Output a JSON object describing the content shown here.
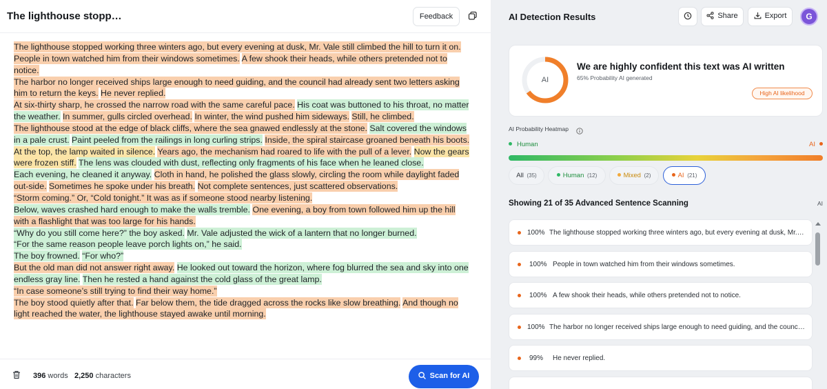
{
  "left": {
    "doc_title": "The lighthouse stopp…",
    "feedback_label": "Feedback",
    "sentences": [
      {
        "t": "The lighthouse stopped working three winters ago, but every evening at dusk, Mr. Vale still climbed the hill to turn it on.",
        "c": "ai",
        "br": true
      },
      {
        "t": "People in town watched him from their windows sometimes.",
        "c": "ai"
      },
      {
        "t": "A few shook their heads, while others pretended not to notice.",
        "c": "ai",
        "br": true
      },
      {
        "t": "The harbor no longer received ships large enough to need guiding, and the council had already sent two letters asking him to return the keys.",
        "c": "ai"
      },
      {
        "t": "He never replied.",
        "c": "ai",
        "br": true
      },
      {
        "t": "At six-thirty sharp, he crossed the narrow road with the same careful pace.",
        "c": "ai"
      },
      {
        "t": "His coat was buttoned to his throat, no matter the weather.",
        "c": "human"
      },
      {
        "t": "In summer, gulls circled overhead.",
        "c": "ai"
      },
      {
        "t": "In winter, the wind pushed him sideways.",
        "c": "ai"
      },
      {
        "t": "Still, he climbed.",
        "c": "ai",
        "br": true
      },
      {
        "t": "The lighthouse stood at the edge of black cliffs, where the sea gnawed endlessly at the stone.",
        "c": "ai"
      },
      {
        "t": "Salt covered the windows in a pale crust.",
        "c": "human"
      },
      {
        "t": "Paint peeled from the railings in long curling strips.",
        "c": "human"
      },
      {
        "t": "Inside, the spiral staircase groaned beneath his boots.",
        "c": "ai",
        "br": true
      },
      {
        "t": "At the top, the lamp waited in silence.",
        "c": "mixed"
      },
      {
        "t": "Years ago, the mechanism had roared to life with the pull of a lever.",
        "c": "ai"
      },
      {
        "t": "Now the gears were frozen stiff.",
        "c": "mixed"
      },
      {
        "t": "The lens was clouded with dust, reflecting only fragments of his face when he leaned close.",
        "c": "human",
        "br": true
      },
      {
        "t": "Each evening, he cleaned it anyway.",
        "c": "human"
      },
      {
        "t": "Cloth in hand, he polished the glass slowly, circling the room while daylight faded out-side.",
        "c": "ai"
      },
      {
        "t": "Sometimes he spoke under his breath.",
        "c": "ai"
      },
      {
        "t": "Not complete sentences, just scattered observations.",
        "c": "ai",
        "br": true
      },
      {
        "t": "“Storm coming.” Or, “Cold tonight.” It was as if someone stood nearby listening.",
        "c": "ai",
        "br": true
      },
      {
        "t": "Below, waves crashed hard enough to make the walls tremble.",
        "c": "human"
      },
      {
        "t": "One evening, a boy from town followed him up the hill with a flashlight that was too large for his hands.",
        "c": "ai",
        "br": true
      },
      {
        "t": "“Why do you still come here?” the boy asked.",
        "c": "human"
      },
      {
        "t": "Mr. Vale adjusted the wick of a lantern that no longer burned.",
        "c": "human",
        "br": true
      },
      {
        "t": "“For the same reason people leave porch lights on,” he said.",
        "c": "human",
        "br": true
      },
      {
        "t": "The boy frowned.",
        "c": "human"
      },
      {
        "t": "“For who?”",
        "c": "human",
        "br": true
      },
      {
        "t": "But the old man did not answer right away.",
        "c": "ai"
      },
      {
        "t": "He looked out toward the horizon, where fog blurred the sea and sky into one endless gray line.",
        "c": "human"
      },
      {
        "t": "Then he rested a hand against the cold glass of the great lamp.",
        "c": "human",
        "br": true
      },
      {
        "t": "“In case someone’s still trying to find their way home.”",
        "c": "ai",
        "br": true
      },
      {
        "t": "The boy stood quietly after that.",
        "c": "ai"
      },
      {
        "t": "Far below them, the tide dragged across the rocks like slow breathing.",
        "c": "ai"
      },
      {
        "t": "And though no light reached the water, the lighthouse stayed awake until morning.",
        "c": "ai"
      }
    ],
    "footer": {
      "words": "396",
      "words_label": "words",
      "chars": "2,250",
      "chars_label": "characters",
      "scan_label": "Scan for AI"
    }
  },
  "right": {
    "title": "AI Detection Results",
    "share_label": "Share",
    "export_label": "Export",
    "avatar_initial": "G",
    "summary": {
      "gauge_label": "AI",
      "gauge_value": 0.65,
      "verdict": "We are highly confident this text was AI written",
      "probability": "65% Probability AI generated",
      "badge": "High AI likelihood"
    },
    "heatmap": {
      "label": "AI Probability Heatmap",
      "left_label": "Human",
      "right_label": "AI"
    },
    "filters": {
      "all": {
        "label": "All",
        "count": "(35)"
      },
      "human": {
        "label": "Human",
        "count": "(12)"
      },
      "mixed": {
        "label": "Mixed",
        "count": "(2)"
      },
      "ai": {
        "label": "AI",
        "count": "(21)"
      }
    },
    "showing": "Showing 21 of 35 Advanced Sentence Scanning",
    "showing_tag": "AI",
    "sentences": [
      {
        "pct": "100%",
        "text": "The lighthouse stopped working three winters ago, but every evening at dusk, Mr. Vale still climbed the hill to turn it on."
      },
      {
        "pct": "100%",
        "text": "People in town watched him from their windows sometimes."
      },
      {
        "pct": "100%",
        "text": "A few shook their heads, while others pretended not to notice."
      },
      {
        "pct": "100%",
        "text": "The harbor no longer received ships large enough to need guiding, and the council had already sent two letters asking him to return the keys."
      },
      {
        "pct": "99%",
        "text": "He never replied."
      },
      {
        "pct": "",
        "text": ""
      }
    ]
  },
  "colors": {
    "ai_highlight": "#f9cfad",
    "human_highlight": "#cdf0d6",
    "mixed_highlight": "#fbe4a7",
    "accent_blue": "#1d5fe8",
    "ai_orange": "#e8651b",
    "human_green": "#1e8e3e"
  }
}
